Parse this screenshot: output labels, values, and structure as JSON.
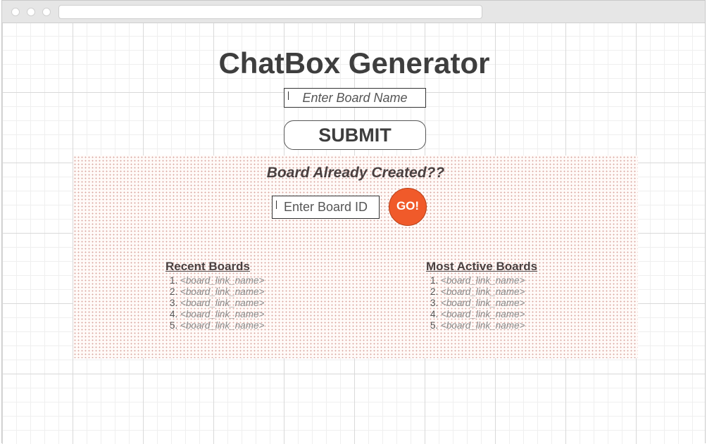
{
  "page": {
    "title": "ChatBox Generator",
    "board_name_placeholder": "Enter Board Name",
    "submit_label": "SUBMIT"
  },
  "existing": {
    "heading": "Board Already Created??",
    "board_id_placeholder": "Enter Board ID",
    "go_label": "GO!",
    "go_color": "#f05a2a"
  },
  "recent_boards": {
    "heading": "Recent Boards",
    "items": [
      "<board_link_name>",
      "<board_link_name>",
      "<board_link_name>",
      "<board_link_name>",
      "<board_link_name>"
    ]
  },
  "active_boards": {
    "heading": "Most Active Boards",
    "items": [
      "<board_link_name>",
      "<board_link_name>",
      "<board_link_name>",
      "<board_link_name>",
      "<board_link_name>"
    ]
  }
}
